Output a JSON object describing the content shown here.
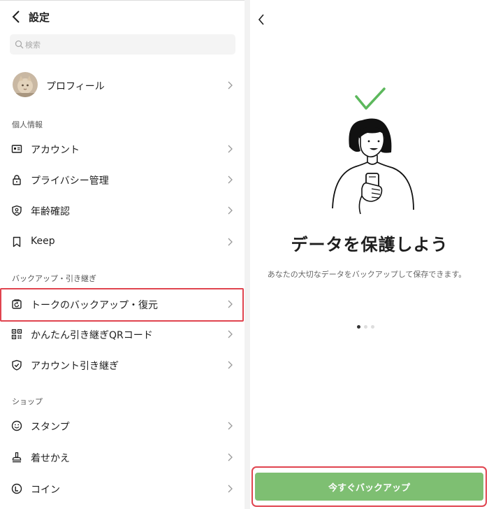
{
  "left": {
    "header": {
      "title": "設定"
    },
    "search": {
      "placeholder": "検索"
    },
    "profile": {
      "label": "プロフィール"
    },
    "sections": {
      "personal": "個人情報",
      "backup": "バックアップ・引き継ぎ",
      "shop": "ショップ"
    },
    "items": {
      "account": "アカウント",
      "privacy": "プライバシー管理",
      "age": "年齢確認",
      "keep": "Keep",
      "talk_backup": "トークのバックアップ・復元",
      "qr_transfer": "かんたん引き継ぎQRコード",
      "account_transfer": "アカウント引き継ぎ",
      "stamp": "スタンプ",
      "theme": "着せかえ",
      "coin": "コイン"
    },
    "icons": {
      "back": "chevron-left-icon",
      "search": "search-icon",
      "account": "id-card-icon",
      "privacy": "lock-icon",
      "age": "shield-person-icon",
      "keep": "bookmark-icon",
      "talk_backup": "backup-restore-icon",
      "qr_transfer": "qr-code-icon",
      "account_transfer": "shield-check-icon",
      "stamp": "smiley-icon",
      "theme": "brush-icon",
      "coin": "coin-icon"
    }
  },
  "right": {
    "title": "データを保護しよう",
    "description": "あなたの大切なデータをバックアップして保存できます。",
    "button": "今すぐバックアップ",
    "pager": {
      "total": 3,
      "active": 1
    }
  },
  "colors": {
    "accent_green": "#7ebf72",
    "check_green": "#5cb85c",
    "highlight_red": "#e0444f",
    "text": "#1e1e1e",
    "muted": "#666666"
  }
}
